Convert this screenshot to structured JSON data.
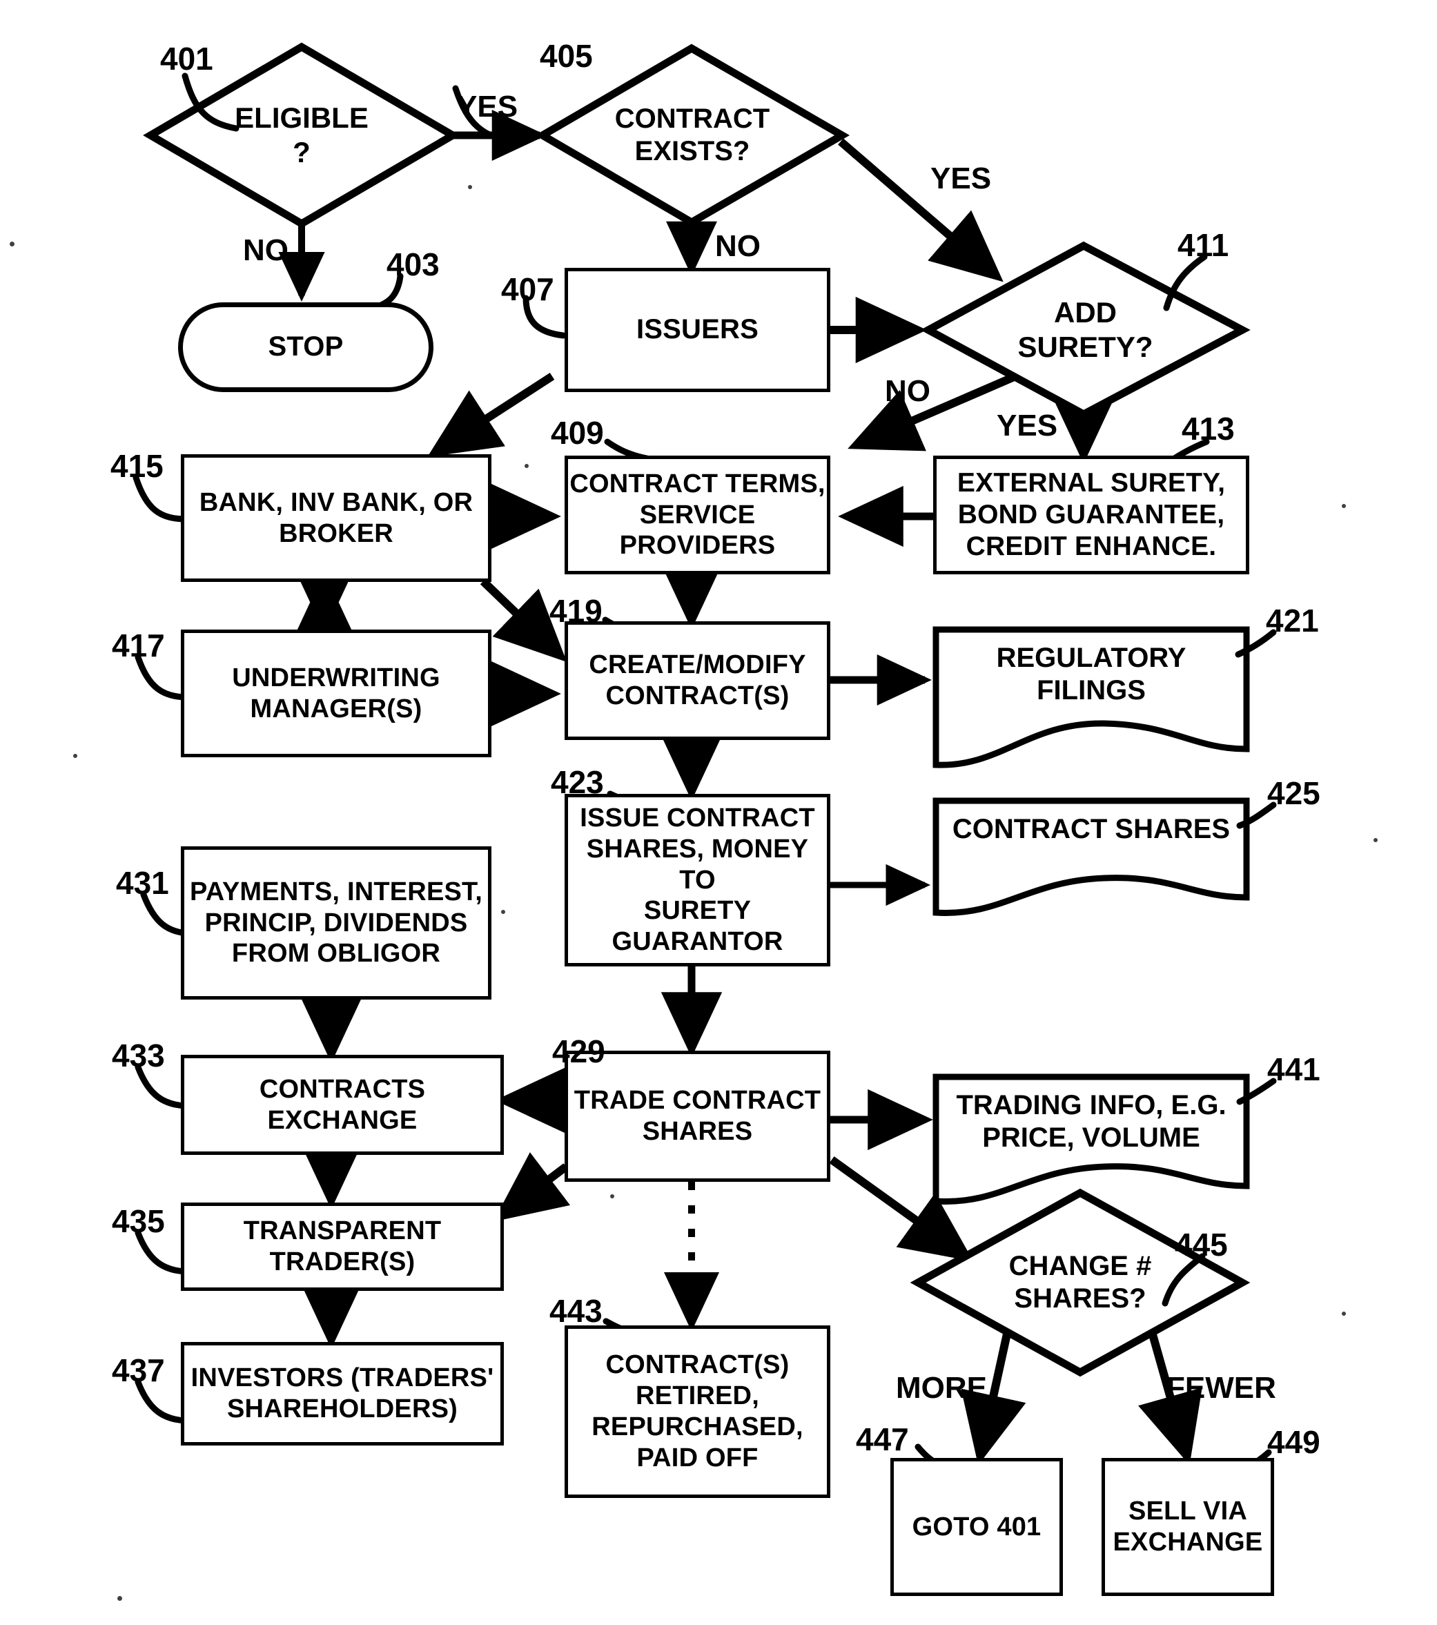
{
  "figure": {
    "type": "patent-flowchart",
    "title": "Contract share issuance and trading process flowchart"
  },
  "nodes": [
    {
      "id": "401",
      "ref": "401",
      "shape": "diamond",
      "label": "ELIGIBLE\n?",
      "text_lines": [
        "ELIGIBLE",
        "?"
      ]
    },
    {
      "id": "403",
      "ref": "403",
      "shape": "stadium",
      "label": "STOP",
      "text_lines": [
        "STOP"
      ]
    },
    {
      "id": "405",
      "ref": "405",
      "shape": "diamond",
      "label": "CONTRACT EXISTS?",
      "text_lines": [
        "CONTRACT",
        "EXISTS?"
      ]
    },
    {
      "id": "407",
      "ref": "407",
      "shape": "box",
      "label": "ISSUERS",
      "text_lines": [
        "ISSUERS"
      ]
    },
    {
      "id": "409",
      "ref": "409",
      "shape": "box",
      "label": "CONTRACT TERMS, SERVICE PROVIDERS",
      "text_lines": [
        "CONTRACT TERMS,",
        "SERVICE",
        "PROVIDERS"
      ]
    },
    {
      "id": "411",
      "ref": "411",
      "shape": "diamond",
      "label": "ADD SURETY?",
      "text_lines": [
        "ADD",
        "SURETY?"
      ]
    },
    {
      "id": "413",
      "ref": "413",
      "shape": "box",
      "label": "EXTERNAL SURETY, BOND GUARANTEE, CREDIT ENHANCE.",
      "text_lines": [
        "EXTERNAL SURETY,",
        "BOND GUARANTEE,",
        "CREDIT ENHANCE."
      ]
    },
    {
      "id": "415",
      "ref": "415",
      "shape": "box",
      "label": "BANK, INV BANK, OR BROKER",
      "text_lines": [
        "BANK, INV BANK, OR",
        "BROKER"
      ]
    },
    {
      "id": "417",
      "ref": "417",
      "shape": "box",
      "label": "UNDERWRITING MANAGER(S)",
      "text_lines": [
        "UNDERWRITING",
        "MANAGER(S)"
      ]
    },
    {
      "id": "419",
      "ref": "419",
      "shape": "box",
      "label": "CREATE/MODIFY CONTRACT(S)",
      "text_lines": [
        "CREATE/MODIFY",
        "CONTRACT(S)"
      ]
    },
    {
      "id": "421",
      "ref": "421",
      "shape": "document",
      "label": "REGULATORY FILINGS",
      "text_lines": [
        "REGULATORY",
        "FILINGS"
      ]
    },
    {
      "id": "423",
      "ref": "423",
      "shape": "box",
      "label": "ISSUE CONTRACT SHARES, MONEY TO SURETY GUARANTOR",
      "text_lines": [
        "ISSUE CONTRACT",
        "SHARES, MONEY TO",
        "SURETY",
        "GUARANTOR"
      ]
    },
    {
      "id": "425",
      "ref": "425",
      "shape": "document",
      "label": "CONTRACT SHARES",
      "text_lines": [
        "CONTRACT SHARES"
      ]
    },
    {
      "id": "429",
      "ref": "429",
      "shape": "box",
      "label": "TRADE CONTRACT SHARES",
      "text_lines": [
        "TRADE CONTRACT",
        "SHARES"
      ]
    },
    {
      "id": "431",
      "ref": "431",
      "shape": "box",
      "label": "PAYMENTS, INTEREST, PRINCIP, DIVIDENDS FROM OBLIGOR",
      "text_lines": [
        "PAYMENTS, INTEREST,",
        "PRINCIP, DIVIDENDS",
        "FROM OBLIGOR"
      ]
    },
    {
      "id": "433",
      "ref": "433",
      "shape": "box",
      "label": "CONTRACTS EXCHANGE",
      "text_lines": [
        "CONTRACTS EXCHANGE"
      ]
    },
    {
      "id": "435",
      "ref": "435",
      "shape": "box",
      "label": "TRANSPARENT TRADER(S)",
      "text_lines": [
        "TRANSPARENT",
        "TRADER(S)"
      ]
    },
    {
      "id": "437",
      "ref": "437",
      "shape": "box",
      "label": "INVESTORS (TRADERS' SHAREHOLDERS)",
      "text_lines": [
        "INVESTORS (TRADERS'",
        "SHAREHOLDERS)"
      ]
    },
    {
      "id": "441",
      "ref": "441",
      "shape": "document",
      "label": "TRADING INFO, E.G. PRICE, VOLUME",
      "text_lines": [
        "TRADING INFO, E.G.",
        "PRICE, VOLUME"
      ]
    },
    {
      "id": "443",
      "ref": "443",
      "shape": "box",
      "label": "CONTRACT(S) RETIRED, REPURCHASED, PAID OFF",
      "text_lines": [
        "CONTRACT(S)",
        "RETIRED,",
        "REPURCHASED,",
        "PAID OFF"
      ]
    },
    {
      "id": "445",
      "ref": "445",
      "shape": "diamond",
      "label": "CHANGE # SHARES?",
      "text_lines": [
        "CHANGE #",
        "SHARES?"
      ]
    },
    {
      "id": "447",
      "ref": "447",
      "shape": "box",
      "label": "GOTO 401",
      "text_lines": [
        "GOTO 401"
      ]
    },
    {
      "id": "449",
      "ref": "449",
      "shape": "box",
      "label": "SELL VIA EXCHANGE",
      "text_lines": [
        "SELL VIA",
        "EXCHANGE"
      ]
    }
  ],
  "edge_labels": [
    {
      "id": "yes-401-405",
      "text": "YES"
    },
    {
      "id": "no-401-403",
      "text": "NO"
    },
    {
      "id": "yes-405-411",
      "text": "YES"
    },
    {
      "id": "no-405-407",
      "text": "NO"
    },
    {
      "id": "no-411-409",
      "text": "NO"
    },
    {
      "id": "yes-411-413",
      "text": "YES"
    },
    {
      "id": "more-445-447",
      "text": "MORE"
    },
    {
      "id": "fewer-445-449",
      "text": "FEWER"
    }
  ],
  "refs": {
    "r401": "401",
    "r403": "403",
    "r405": "405",
    "r407": "407",
    "r409": "409",
    "r411": "411",
    "r413": "413",
    "r415": "415",
    "r417": "417",
    "r419": "419",
    "r421": "421",
    "r423": "423",
    "r425": "425",
    "r429": "429",
    "r431": "431",
    "r433": "433",
    "r435": "435",
    "r437": "437",
    "r441": "441",
    "r443": "443",
    "r445": "445",
    "r447": "447",
    "r449": "449"
  },
  "node_text": {
    "n401_l1": "ELIGIBLE",
    "n401_l2": "?",
    "n403": "STOP",
    "n405_l1": "CONTRACT",
    "n405_l2": "EXISTS?",
    "n407": "ISSUERS",
    "n409_l1": "CONTRACT TERMS,",
    "n409_l2": "SERVICE",
    "n409_l3": "PROVIDERS",
    "n411_l1": "ADD",
    "n411_l2": "SURETY?",
    "n413_l1": "EXTERNAL SURETY,",
    "n413_l2": "BOND GUARANTEE,",
    "n413_l3": "CREDIT ENHANCE.",
    "n415_l1": "BANK, INV BANK, OR",
    "n415_l2": "BROKER",
    "n417_l1": "UNDERWRITING",
    "n417_l2": "MANAGER(S)",
    "n419_l1": "CREATE/MODIFY",
    "n419_l2": "CONTRACT(S)",
    "n421_l1": "REGULATORY",
    "n421_l2": "FILINGS",
    "n423_l1": "ISSUE CONTRACT",
    "n423_l2": "SHARES, MONEY TO",
    "n423_l3": "SURETY",
    "n423_l4": "GUARANTOR",
    "n425": "CONTRACT SHARES",
    "n429_l1": "TRADE CONTRACT",
    "n429_l2": "SHARES",
    "n431_l1": "PAYMENTS, INTEREST,",
    "n431_l2": "PRINCIP, DIVIDENDS",
    "n431_l3": "FROM OBLIGOR",
    "n433": "CONTRACTS EXCHANGE",
    "n435_l1": "TRANSPARENT",
    "n435_l2": "TRADER(S)",
    "n437_l1": "INVESTORS (TRADERS'",
    "n437_l2": "SHAREHOLDERS)",
    "n441_l1": "TRADING INFO, E.G.",
    "n441_l2": "PRICE, VOLUME",
    "n443_l1": "CONTRACT(S)",
    "n443_l2": "RETIRED,",
    "n443_l3": "REPURCHASED,",
    "n443_l4": "PAID OFF",
    "n445_l1": "CHANGE #",
    "n445_l2": "SHARES?",
    "n447": "GOTO 401",
    "n449_l1": "SELL VIA",
    "n449_l2": "EXCHANGE"
  },
  "labels": {
    "yes1": "YES",
    "no1": "NO",
    "yes2": "YES",
    "no2": "NO",
    "no3": "NO",
    "yes3": "YES",
    "more": "MORE",
    "fewer": "FEWER"
  },
  "colors": {
    "ink": "#000000",
    "paper": "#ffffff"
  }
}
